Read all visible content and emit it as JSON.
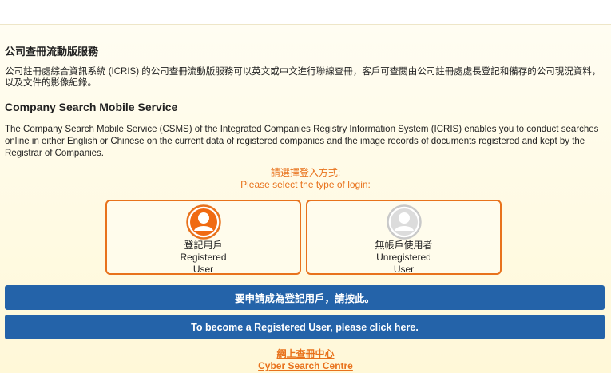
{
  "colors": {
    "accent": "#e8721c",
    "button_blue": "#2463a9"
  },
  "zh": {
    "title": "公司查冊流動版服務",
    "description": "公司註冊處綜合資訊系統 (ICRIS) 的公司查冊流動版服務可以英文或中文進行聯線查冊，客戶可查閱由公司註冊處處長登記和備存的公司現況資料，以及文件的影像紀錄。"
  },
  "en": {
    "title": "Company Search Mobile Service",
    "description": "The Company Search Mobile Service (CSMS) of the Integrated Companies Registry Information System (ICRIS) enables you to conduct searches online in either English or Chinese on the current data of registered companies and the image records of documents registered and kept by the Registrar of Companies."
  },
  "login": {
    "prompt_zh": "請選擇登入方式:",
    "prompt_en": "Please select the type of login:",
    "registered": {
      "label_zh": "登記用戶",
      "label_en_1": "Registered",
      "label_en_2": "User",
      "icon": "user-avatar-icon-orange"
    },
    "unregistered": {
      "label_zh": "無帳戶使用者",
      "label_en_1": "Unregistered",
      "label_en_2": "User",
      "icon": "user-avatar-icon-grey"
    }
  },
  "buttons": {
    "register_zh": "要申請成為登記用戶，請按此。",
    "register_en": "To become a Registered User, please click here."
  },
  "footer": {
    "link_zh": "網上查冊中心",
    "link_en": "Cyber Search Centre"
  }
}
